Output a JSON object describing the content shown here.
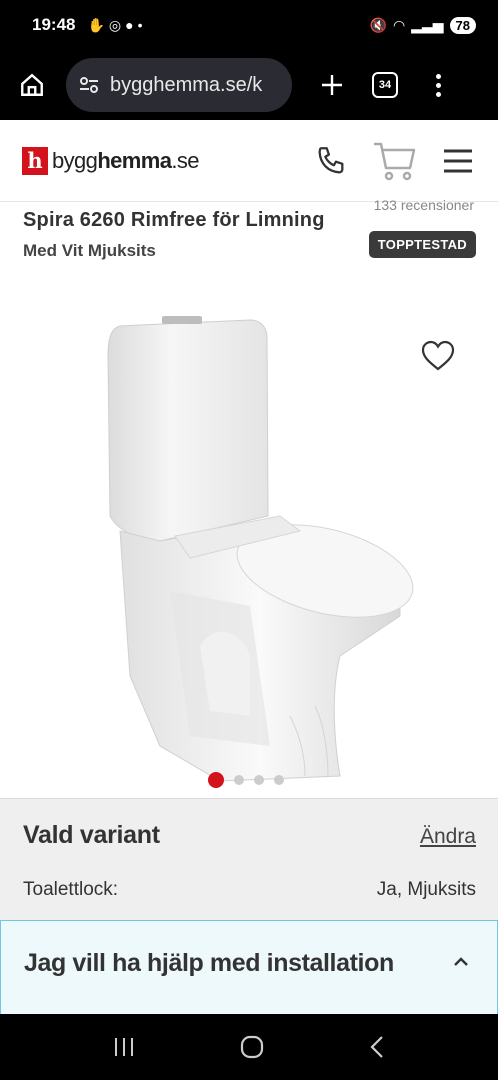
{
  "status": {
    "time": "19:48",
    "battery": "78"
  },
  "browser": {
    "url": "bygghemma.se/k",
    "tab_count": "34"
  },
  "site": {
    "logo_mark": "h",
    "logo_prefix": "bygg",
    "logo_bold": "hemma",
    "logo_suffix": ".se"
  },
  "product": {
    "reviews": "133 recensioner",
    "title": "Spira 6260 Rimfree för Limning",
    "subtitle": "Med Vit Mjuksits",
    "badge": "TOPPTESTAD",
    "image_count": 4,
    "active_image": 1
  },
  "variant": {
    "title": "Vald variant",
    "change_label": "Ändra",
    "attr_label": "Toalettlock:",
    "attr_value": "Ja, Mjuksits"
  },
  "install": {
    "title": "Jag vill ha hjälp med installation"
  },
  "colors": {
    "brand": "#d4121c",
    "install_bg": "#eef9fc",
    "install_border": "#6ec8e0"
  }
}
